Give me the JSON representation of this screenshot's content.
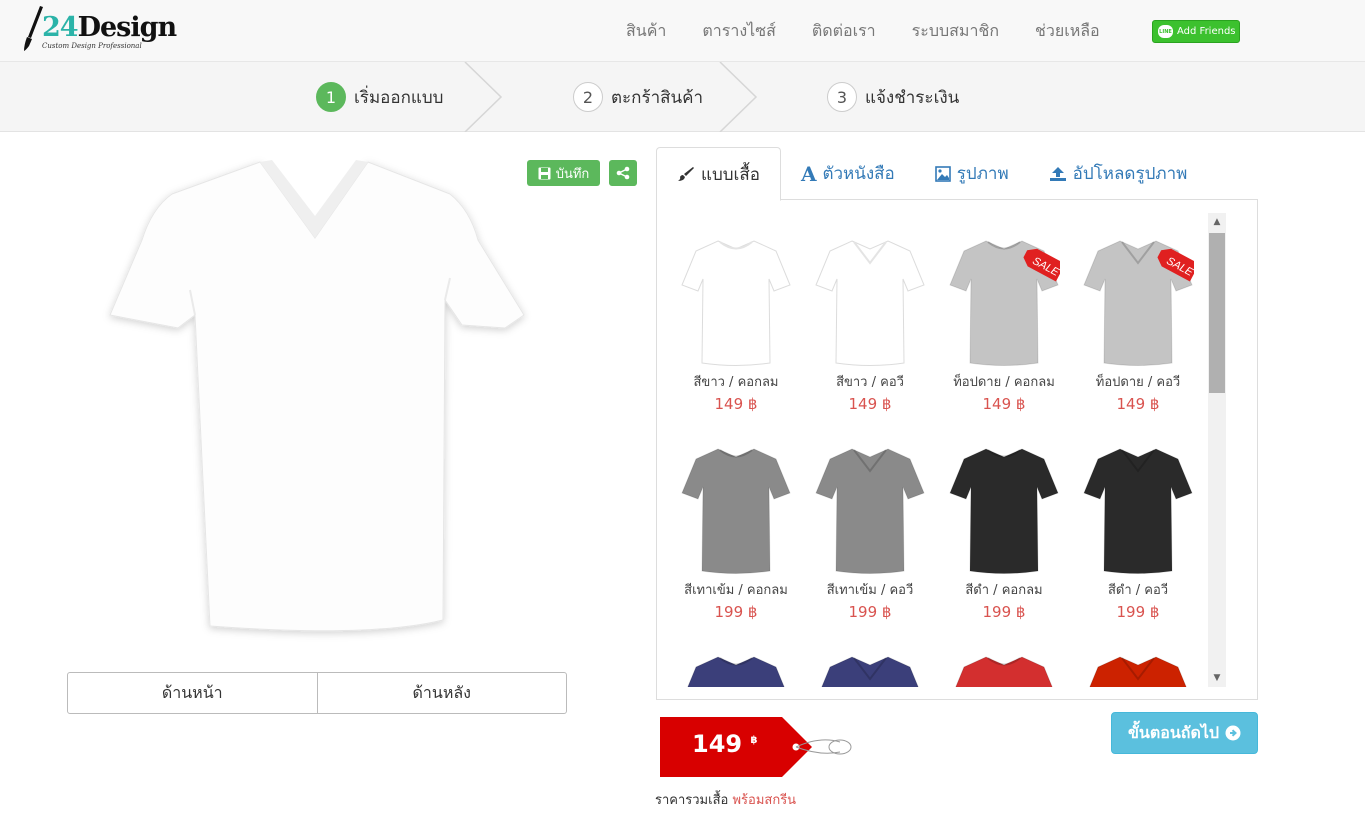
{
  "header": {
    "logo_text_num": "24",
    "logo_text_word": "Design",
    "logo_tagline": "Custom Design Professional",
    "nav": [
      "สินค้า",
      "ตารางไซส์",
      "ติดต่อเรา",
      "ระบบสมาชิก",
      "ช่วยเหลือ"
    ],
    "line_label": "Add Friends",
    "line_icon_text": "LINE"
  },
  "steps": [
    {
      "num": "1",
      "label": "เริ่มออกแบบ",
      "active": true
    },
    {
      "num": "2",
      "label": "ตะกร้าสินค้า",
      "active": false
    },
    {
      "num": "3",
      "label": "แจ้งชำระเงิน",
      "active": false
    }
  ],
  "toolbar": {
    "save_label": "บันทึก",
    "save_icon": "floppy-icon",
    "share_icon": "share-icon"
  },
  "preview": {
    "front_label": "ด้านหน้า",
    "back_label": "ด้านหลัง"
  },
  "tabs": [
    {
      "label": "แบบเสื้อ",
      "icon": "brush-icon"
    },
    {
      "label": "ตัวหนังสือ",
      "icon": "font-icon"
    },
    {
      "label": "รูปภาพ",
      "icon": "image-icon"
    },
    {
      "label": "อัปโหลดรูปภาพ",
      "icon": "upload-icon"
    }
  ],
  "products": [
    {
      "name": "สีขาว / คอกลม",
      "price": "149 ฿",
      "color": "#ffffff",
      "neck": "crew",
      "sale": false
    },
    {
      "name": "สีขาว / คอวี",
      "price": "149 ฿",
      "color": "#ffffff",
      "neck": "v",
      "sale": false
    },
    {
      "name": "ท็อปดาย / คอกลม",
      "price": "149 ฿",
      "color": "#c4c4c4",
      "neck": "crew",
      "sale": true
    },
    {
      "name": "ท็อปดาย / คอวี",
      "price": "149 ฿",
      "color": "#c4c4c4",
      "neck": "v",
      "sale": true
    },
    {
      "name": "สีเทาเข้ม / คอกลม",
      "price": "199 ฿",
      "color": "#8a8a8a",
      "neck": "crew",
      "sale": false
    },
    {
      "name": "สีเทาเข้ม / คอวี",
      "price": "199 ฿",
      "color": "#8a8a8a",
      "neck": "v",
      "sale": false
    },
    {
      "name": "สีดำ / คอกลม",
      "price": "199 ฿",
      "color": "#2a2a2a",
      "neck": "crew",
      "sale": false
    },
    {
      "name": "สีดำ / คอวี",
      "price": "199 ฿",
      "color": "#2a2a2a",
      "neck": "v",
      "sale": false
    },
    {
      "name": "",
      "price": "",
      "color": "#3b3f7a",
      "neck": "crew",
      "sale": false
    },
    {
      "name": "",
      "price": "",
      "color": "#3b3f7a",
      "neck": "v",
      "sale": false
    },
    {
      "name": "",
      "price": "",
      "color": "#d32f2f",
      "neck": "crew",
      "sale": false
    },
    {
      "name": "",
      "price": "",
      "color": "#cc2200",
      "neck": "v",
      "sale": false
    }
  ],
  "sale_label": "SALE",
  "price": {
    "amount": "149",
    "currency": "฿",
    "caption": "ราคารวมเสื้อ",
    "caption_highlight": "พร้อมสกรีน"
  },
  "next_label": "ขั้นตอนถัดไป",
  "colors": {
    "green": "#5cb85c",
    "blue": "#5bc0de",
    "red": "#d9534f",
    "tag_red": "#d80000"
  }
}
